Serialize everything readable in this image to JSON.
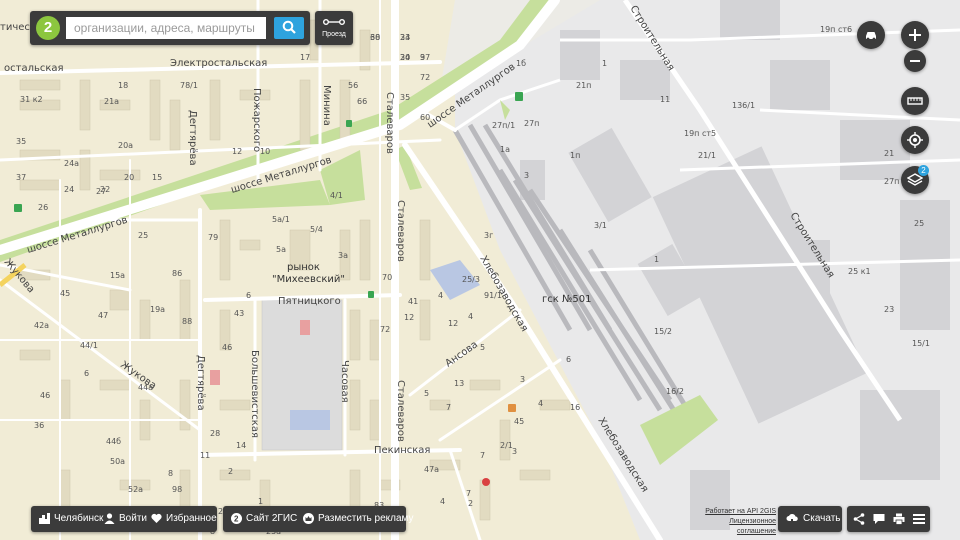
{
  "search": {
    "placeholder": "организации, адреса, маршруты"
  },
  "route_button": {
    "label": "Проезд"
  },
  "bottom_left": {
    "city": "Челябинск",
    "login": "Войти",
    "favorites": "Избранное"
  },
  "bottom_mid": {
    "site": "Сайт 2ГИС",
    "ads": "Разместить рекламу"
  },
  "credits": {
    "api": "Работает на API 2GIS",
    "license": "Лицензионное соглашение"
  },
  "download": {
    "label": "Скачать"
  },
  "layers_badge": "2",
  "colors": {
    "accent": "#2ea3de",
    "panel": "#3b3b3b",
    "brand": "#8cc63f",
    "map_bg": "#f1ecd6",
    "industrial": "#e9e9ea"
  },
  "streets": {
    "elektrostalskaya": "Электростальская",
    "metallurgov_top": "шоссе Металлургов",
    "metallurgov_mid": "шоссе Металлургов",
    "metallurgov_left": "шоссе Металлургов",
    "stalevarov_top": "Сталеваров",
    "stalevarov_mid": "Сталеваров",
    "stalevarov_bot": "Сталеваров",
    "pyatnitskogo": "Пятницкого",
    "degtyareva_top": "Дегтярёва",
    "degtyareva_bot": "Дегтярёва",
    "pozharskogo": "Пожарского",
    "minina": "Минина",
    "bolshevistskaya": "Большевистская",
    "chasovaya": "Часовая",
    "zhukova_top": "Жукова",
    "zhukova_mid": "Жукова",
    "ansova": "Ансова",
    "pekinskaya": "Пекинская",
    "khlebozavod_top": "Хлебозаводская",
    "khlebozavod_bot": "Хлебозаводская",
    "stroitelnaya_top": "Строительная",
    "stroitelnaya_mid": "Строительная",
    "elektrostalskaya_short": "остальская",
    "tichesk": "тическ"
  },
  "places": {
    "market_name": "рынок",
    "market_title": "\"Михеевский\"",
    "gsk": "гск №501"
  },
  "house_numbers": [
    "60",
    "33",
    "34",
    "37",
    "72",
    "17",
    "78/1",
    "56",
    "35",
    "60",
    "31 к2",
    "21а",
    "18",
    "66",
    "35",
    "20а",
    "12",
    "10",
    "37",
    "24а",
    "20",
    "15",
    "27",
    "24",
    "22",
    "26",
    "25",
    "5а/1",
    "5/4",
    "79",
    "5а",
    "3а",
    "70",
    "41",
    "15а",
    "86",
    "6",
    "43",
    "45",
    "47",
    "19а",
    "88",
    "72",
    "12",
    "4",
    "42а",
    "44/1",
    "46",
    "6",
    "46",
    "44а",
    "36",
    "44б",
    "50а",
    "52а",
    "98",
    "2",
    "1",
    "25а",
    "83",
    "24",
    "8",
    "91/1",
    "27п",
    "1а",
    "27п/1",
    "21п",
    "1",
    "1б",
    "1п",
    "11",
    "136/1",
    "19п ст6",
    "19п ст5",
    "21/1",
    "21",
    "27п стр1",
    "3",
    "3/1",
    "1",
    "3г",
    "4/1",
    "4",
    "25/3",
    "25",
    "25 к1",
    "23",
    "15/1",
    "15/2",
    "16/2",
    "6",
    "45",
    "5",
    "7",
    "3",
    "4",
    "3",
    "16",
    "47а",
    "7",
    "4",
    "2",
    "2/1",
    "7",
    "5",
    "13",
    "12",
    "11",
    "14",
    "8",
    "28",
    "38",
    "24",
    "20",
    "9"
  ]
}
